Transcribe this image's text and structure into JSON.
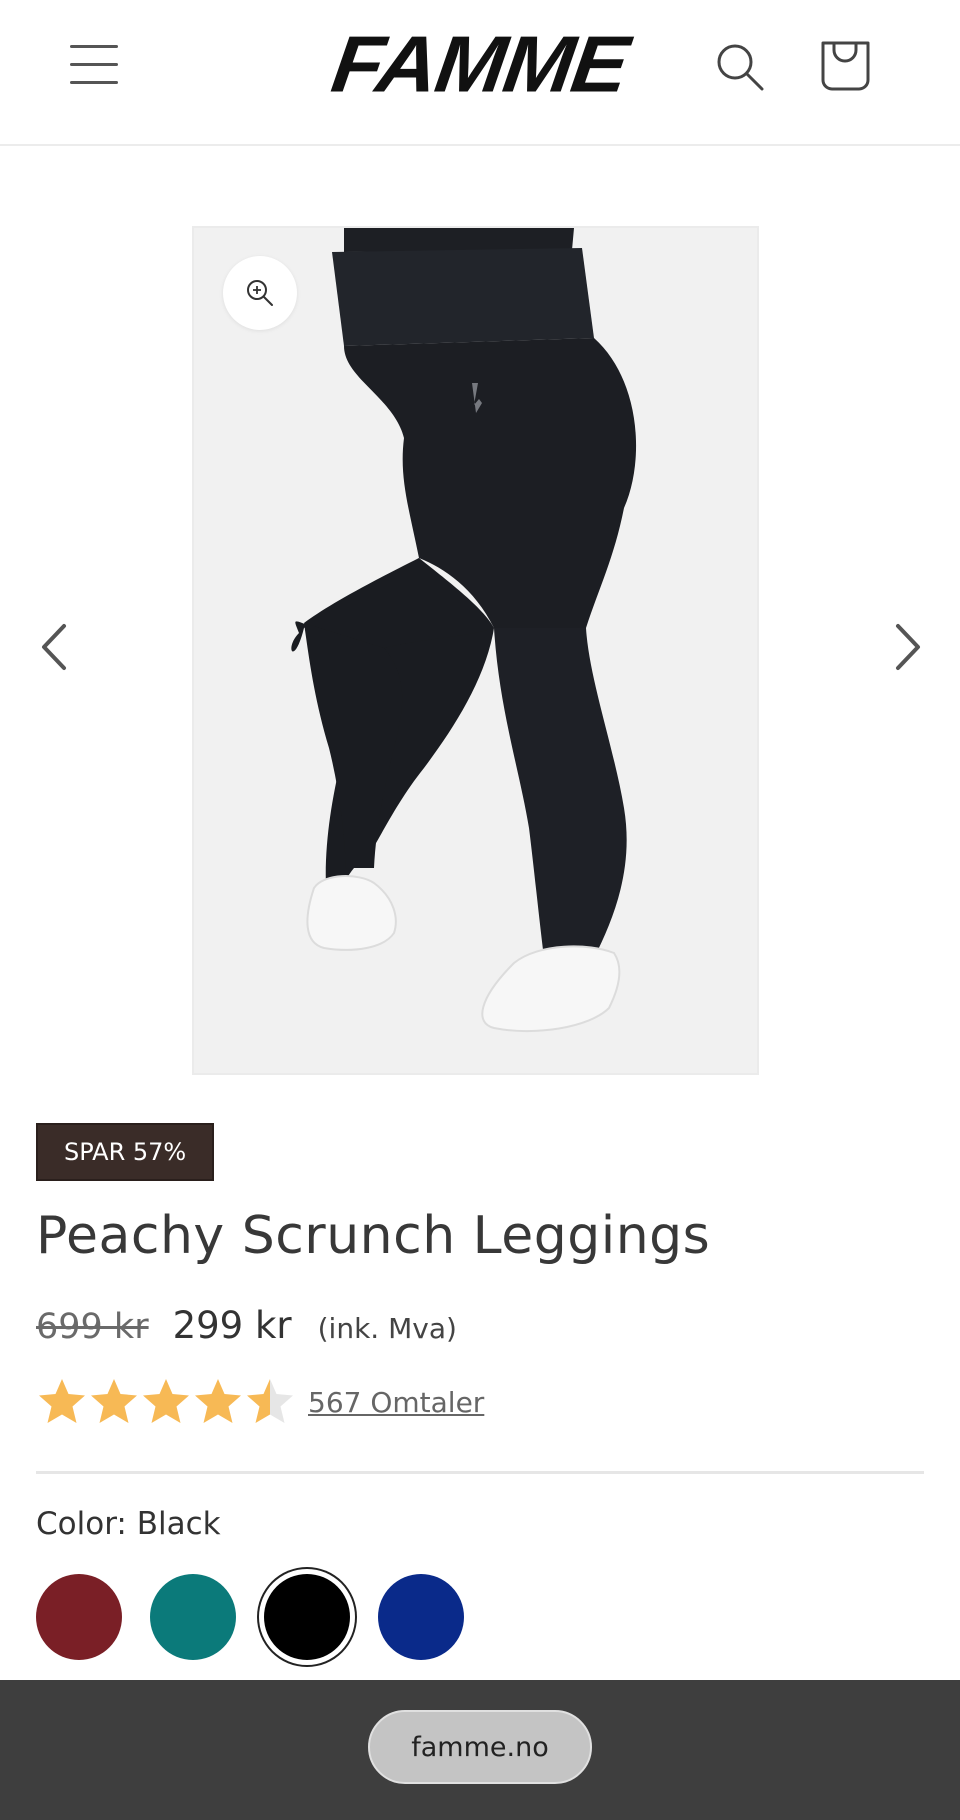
{
  "header": {
    "brand": "FAMME",
    "menu_icon": "hamburger-menu-icon",
    "search_icon": "search-icon",
    "cart_icon": "shopping-bag-icon"
  },
  "gallery": {
    "zoom_icon": "zoom-in-icon",
    "prev_icon": "chevron-left-icon",
    "next_icon": "chevron-right-icon",
    "image_alt": "Peachy Scrunch Leggings product photo"
  },
  "product": {
    "badge": "SPAR 57%",
    "title": "Peachy Scrunch Leggings",
    "old_price": "699 kr",
    "price": "299 kr",
    "tax_note": "(ink. Mva)",
    "rating": 4.5,
    "rating_max": 5,
    "star_color": "#f7b955",
    "star_empty_color": "#e6e6e6",
    "reviews": "567 Omtaler",
    "color_label": "Color: Black",
    "swatches": [
      {
        "name": "Burgundy",
        "color": "#7a1f26"
      },
      {
        "name": "Teal",
        "color": "#0b7a7a"
      },
      {
        "name": "Black",
        "color": "#000000",
        "selected": true
      },
      {
        "name": "Blue",
        "color": "#0a2a8a"
      }
    ]
  },
  "browser": {
    "url": "famme.no"
  }
}
